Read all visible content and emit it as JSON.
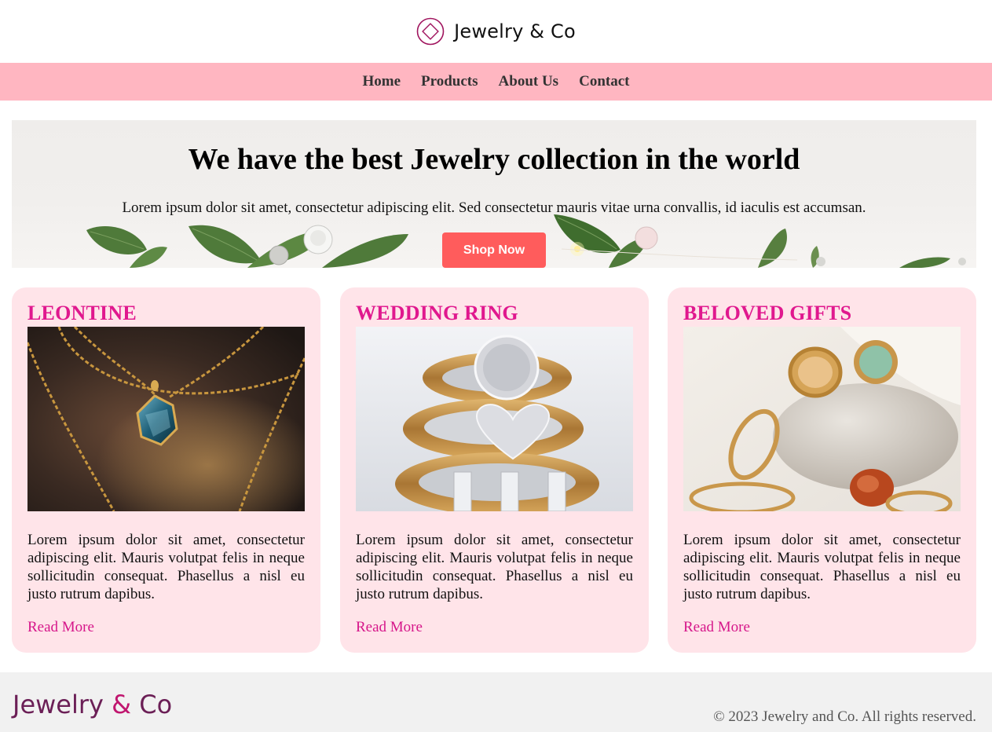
{
  "brand": {
    "name": "Jewelry & Co"
  },
  "nav": {
    "items": [
      "Home",
      "Products",
      "About Us",
      "Contact"
    ]
  },
  "hero": {
    "title": "We have the best Jewelry collection in the world",
    "subtitle": "Lorem ipsum dolor sit amet, consectetur adipiscing elit. Sed consectetur mauris vitae urna convallis, id iaculis est accumsan.",
    "button_label": "Shop Now"
  },
  "cards": [
    {
      "title": "LEONTINE",
      "image": "gold-chain-blue-pendant-photo",
      "text": "Lorem ipsum dolor sit amet, consectetur adipiscing elit. Mauris volutpat felis in neque sollicitudin consequat. Phasellus a nisl eu justo rutrum dapibus.",
      "link": "Read More"
    },
    {
      "title": "WEDDING RING",
      "image": "stacked-gold-diamond-rings-photo",
      "text": "Lorem ipsum dolor sit amet, consectetur adipiscing elit. Mauris volutpat felis in neque sollicitudin consequat. Phasellus a nisl eu justo rutrum dapibus.",
      "link": "Read More"
    },
    {
      "title": "BELOVED GIFTS",
      "image": "gold-rings-on-stone-photo",
      "text": "Lorem ipsum dolor sit amet, consectetur adipiscing elit. Mauris volutpat felis in neque sollicitudin consequat. Phasellus a nisl eu justo rutrum dapibus.",
      "link": "Read More"
    }
  ],
  "footer": {
    "logo_part1": "Jewelry ",
    "logo_amp": "&",
    "logo_part2": " Co",
    "copyright": "© 2023 Jewelry and Co. All rights reserved."
  },
  "colors": {
    "nav_bg": "#ffb6c1",
    "card_bg": "#ffe4e9",
    "accent_pink": "#e0188e",
    "button_bg": "#ff5c5c",
    "footer_bg": "#f1f1f1"
  }
}
